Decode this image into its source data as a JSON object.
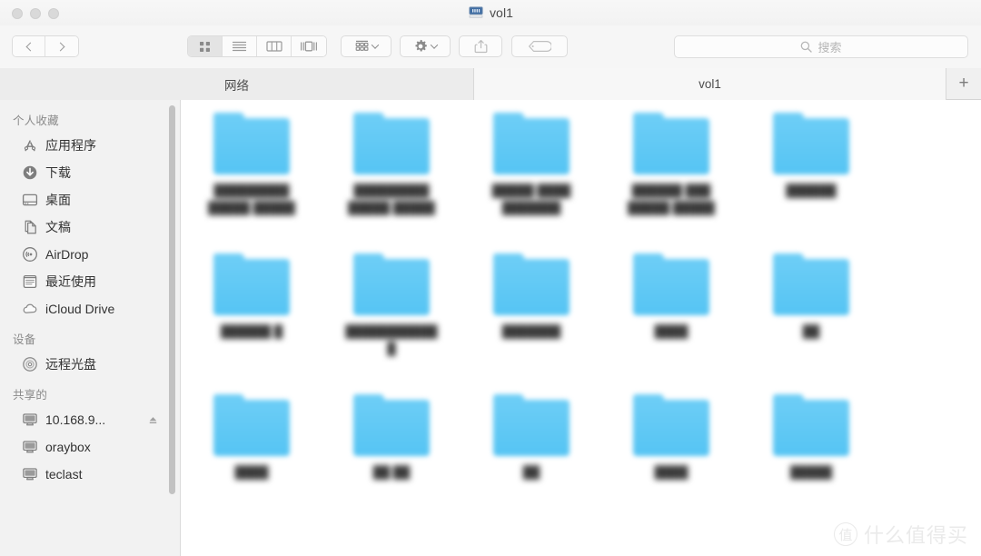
{
  "window": {
    "title": "vol1",
    "title_icon": "network-drive-icon",
    "traffic_lights": [
      "close-button",
      "minimize-button",
      "zoom-button"
    ]
  },
  "toolbar": {
    "back_label": "chevron-left-icon",
    "forward_label": "chevron-right-icon",
    "view_modes": [
      {
        "name": "icon-view",
        "icon": "grid-view-icon",
        "active": true
      },
      {
        "name": "list-view",
        "icon": "list-view-icon",
        "active": false
      },
      {
        "name": "column-view",
        "icon": "column-view-icon",
        "active": false
      },
      {
        "name": "gallery-view",
        "icon": "gallery-view-icon",
        "active": false
      }
    ],
    "arrange": {
      "name": "arrange-button",
      "icon": "arrange-grid-icon"
    },
    "action": {
      "name": "action-button",
      "icon": "gear-icon"
    },
    "share": {
      "name": "share-button",
      "icon": "share-upload-icon",
      "disabled": true
    },
    "tags": {
      "name": "tags-button",
      "icon": "tag-icon",
      "disabled": true
    }
  },
  "search": {
    "placeholder": "搜索",
    "value": "",
    "icon": "search-icon"
  },
  "tabs": {
    "items": [
      {
        "label": "网络",
        "active": false
      },
      {
        "label": "vol1",
        "active": true
      }
    ],
    "add_label": "+"
  },
  "sidebar": {
    "sections": [
      {
        "title": "个人收藏",
        "items": [
          {
            "label": "应用程序",
            "icon": "applications-icon"
          },
          {
            "label": "下载",
            "icon": "downloads-icon"
          },
          {
            "label": "桌面",
            "icon": "desktop-icon"
          },
          {
            "label": "文稿",
            "icon": "documents-icon"
          },
          {
            "label": "AirDrop",
            "icon": "airdrop-icon"
          },
          {
            "label": "最近使用",
            "icon": "recents-icon"
          },
          {
            "label": "iCloud Drive",
            "icon": "icloud-icon"
          }
        ]
      },
      {
        "title": "设备",
        "items": [
          {
            "label": "远程光盘",
            "icon": "remote-disc-icon"
          }
        ]
      },
      {
        "title": "共享的",
        "items": [
          {
            "label": "10.168.9...",
            "icon": "server-icon",
            "eject": true
          },
          {
            "label": "oraybox",
            "icon": "server-icon"
          },
          {
            "label": "teclast",
            "icon": "server-icon"
          }
        ]
      }
    ]
  },
  "content": {
    "folder_color": "#5BC6F4",
    "labels_redacted": true,
    "rows": [
      {
        "cells": [
          {
            "icon": "folder-icon",
            "label_lines": [
              "█████████",
              "█████ █████"
            ]
          },
          {
            "icon": "folder-icon",
            "label_lines": [
              "█████████",
              "█████ █████"
            ]
          },
          {
            "icon": "folder-icon",
            "label_lines": [
              "█████ ████",
              "███████"
            ]
          },
          {
            "icon": "folder-icon",
            "label_lines": [
              "██████ ███",
              "█████ █████"
            ]
          },
          {
            "icon": "folder-icon",
            "label_lines": [
              "██████"
            ]
          }
        ]
      },
      {
        "cells": [
          {
            "icon": "folder-icon",
            "label_lines": [
              "██████ █"
            ]
          },
          {
            "icon": "folder-icon",
            "label_lines": [
              "███████████",
              "█"
            ]
          },
          {
            "icon": "folder-icon",
            "label_lines": [
              "███████"
            ]
          },
          {
            "icon": "folder-icon",
            "label_lines": [
              "████"
            ]
          },
          {
            "icon": "folder-icon",
            "label_lines": [
              "██"
            ]
          }
        ]
      },
      {
        "cells": [
          {
            "icon": "folder-icon",
            "label_lines": [
              "████"
            ]
          },
          {
            "icon": "folder-icon",
            "label_lines": [
              "██ ██"
            ]
          },
          {
            "icon": "folder-icon",
            "label_lines": [
              "██"
            ]
          },
          {
            "icon": "folder-icon",
            "label_lines": [
              "████"
            ]
          },
          {
            "icon": "folder-icon",
            "label_lines": [
              "█████"
            ]
          }
        ]
      }
    ]
  },
  "watermark": {
    "badge": "值",
    "text": "什么值得买"
  }
}
